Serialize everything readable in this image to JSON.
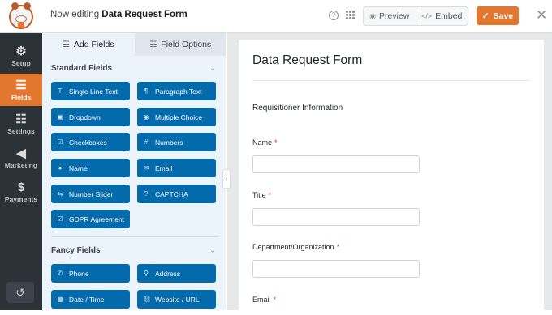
{
  "header": {
    "editing_prefix": "Now editing",
    "form_name": "Data Request Form",
    "preview_label": "Preview",
    "embed_label": "Embed",
    "save_label": "Save",
    "icons": {
      "help": "help-icon",
      "apps": "grid-icon",
      "preview": "eye-icon",
      "embed": "code-icon",
      "save": "check-icon",
      "close": "close-icon"
    }
  },
  "sidebar": {
    "items": [
      {
        "label": "Setup",
        "icon": "gear-icon",
        "active": false
      },
      {
        "label": "Fields",
        "icon": "list-icon",
        "active": true
      },
      {
        "label": "Settings",
        "icon": "sliders-icon",
        "active": false
      },
      {
        "label": "Marketing",
        "icon": "megaphone-icon",
        "active": false
      },
      {
        "label": "Payments",
        "icon": "dollar-icon",
        "active": false
      }
    ],
    "history_icon": "history-icon"
  },
  "panel": {
    "tabs": [
      {
        "label": "Add Fields",
        "icon": "list-icon",
        "active": true
      },
      {
        "label": "Field Options",
        "icon": "sliders-icon",
        "active": false
      }
    ],
    "standard_title": "Standard Fields",
    "standard_fields": [
      {
        "label": "Single Line Text",
        "icon": "text-icon"
      },
      {
        "label": "Paragraph Text",
        "icon": "paragraph-icon"
      },
      {
        "label": "Dropdown",
        "icon": "dropdown-icon"
      },
      {
        "label": "Multiple Choice",
        "icon": "radio-icon"
      },
      {
        "label": "Checkboxes",
        "icon": "checkbox-icon"
      },
      {
        "label": "Numbers",
        "icon": "hash-icon"
      },
      {
        "label": "Name",
        "icon": "user-icon"
      },
      {
        "label": "Email",
        "icon": "envelope-icon"
      },
      {
        "label": "Number Slider",
        "icon": "slider-icon"
      },
      {
        "label": "CAPTCHA",
        "icon": "question-icon"
      },
      {
        "label": "GDPR Agreement",
        "icon": "checkbox-icon"
      }
    ],
    "fancy_title": "Fancy Fields",
    "fancy_fields": [
      {
        "label": "Phone",
        "icon": "phone-icon"
      },
      {
        "label": "Address",
        "icon": "map-pin-icon"
      },
      {
        "label": "Date / Time",
        "icon": "calendar-icon"
      },
      {
        "label": "Website / URL",
        "icon": "link-icon"
      }
    ]
  },
  "form": {
    "title": "Data Request Form",
    "section": "Requisitioner Information",
    "fields": [
      {
        "label": "Name",
        "required": "*"
      },
      {
        "label": "Title",
        "required": "*"
      },
      {
        "label": "Department/Organization",
        "required": "*"
      },
      {
        "label": "Email",
        "required": "*"
      }
    ]
  },
  "colors": {
    "accent": "#e27730",
    "field_button": "#036aab",
    "sidebar": "#2c3338",
    "panel": "#ebf3fb"
  }
}
